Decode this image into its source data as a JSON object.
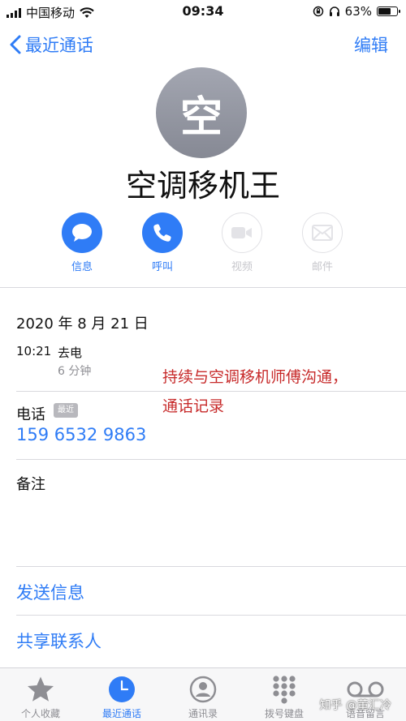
{
  "status_bar": {
    "carrier": "中国移动",
    "time": "09:34",
    "battery": "63%"
  },
  "nav": {
    "back_label": "最近通话",
    "edit_label": "编辑"
  },
  "contact": {
    "avatar_char": "空",
    "name": "空调移机王"
  },
  "actions": [
    {
      "label": "信息",
      "icon": "message-icon",
      "enabled": true
    },
    {
      "label": "呼叫",
      "icon": "phone-icon",
      "enabled": true
    },
    {
      "label": "视频",
      "icon": "video-icon",
      "enabled": false
    },
    {
      "label": "邮件",
      "icon": "mail-icon",
      "enabled": false
    }
  ],
  "call_log": {
    "date": "2020 年 8 月 21 日",
    "time": "10:21",
    "type": "去电",
    "duration": "6 分钟"
  },
  "annotation": {
    "line1": "持续与空调移机师傅沟通，",
    "line2": "通话记录"
  },
  "phone": {
    "label": "电话",
    "badge": "最近",
    "number": "159 6532 9863"
  },
  "notes": {
    "label": "备注"
  },
  "links": {
    "send_message": "发送信息",
    "share_contact": "共享联系人"
  },
  "tabs": [
    {
      "label": "个人收藏",
      "icon": "star-icon",
      "active": false
    },
    {
      "label": "最近通话",
      "icon": "clock-icon",
      "active": true
    },
    {
      "label": "通讯录",
      "icon": "contacts-icon",
      "active": false
    },
    {
      "label": "拨号键盘",
      "icon": "keypad-icon",
      "active": false
    },
    {
      "label": "语音留言",
      "icon": "voicemail-icon",
      "active": false
    }
  ],
  "watermark": "知乎 @董汇冷",
  "colors": {
    "accent": "#2f7cf6",
    "annotation": "#c72a2a",
    "disabled": "#c7c7cc"
  }
}
